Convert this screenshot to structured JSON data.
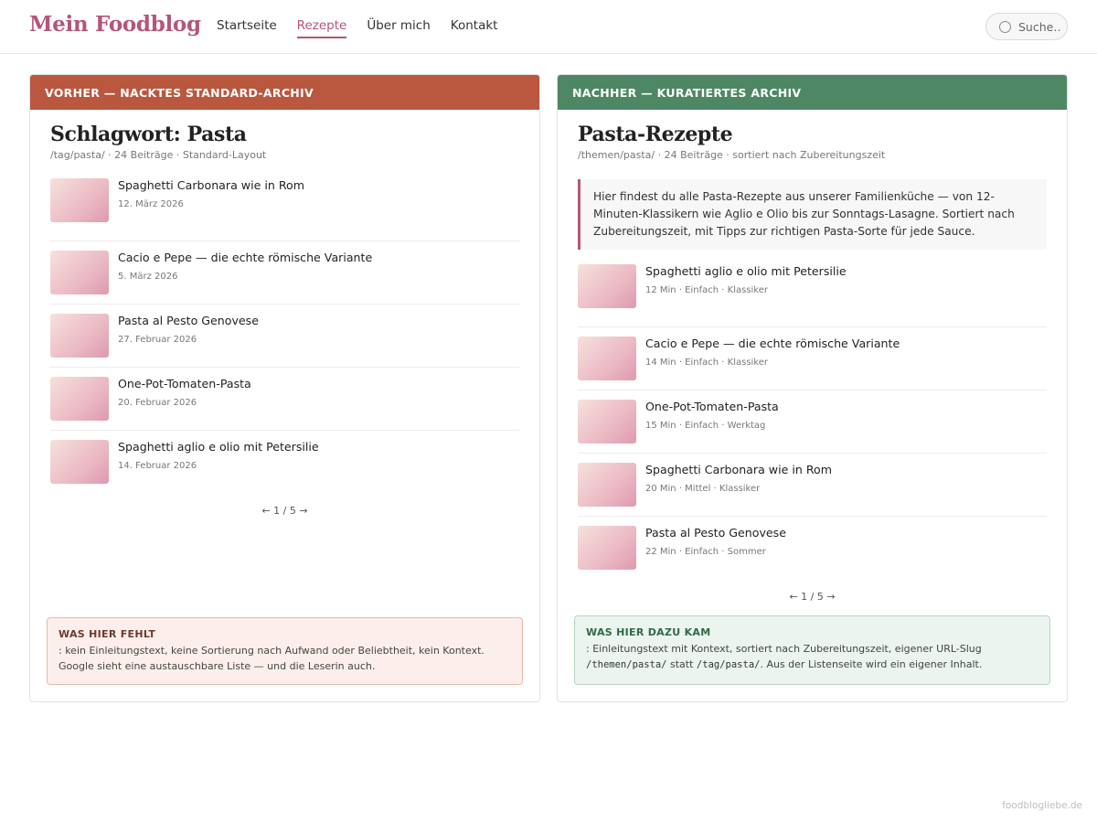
{
  "site": {
    "brand": "Mein Foodblog",
    "nav": [
      "Startseite",
      "Rezepte",
      "Über mich",
      "Kontakt"
    ],
    "active_nav": "Rezepte",
    "search_placeholder": "Suche…",
    "credit": "foodblogliebe.de"
  },
  "colors": {
    "brand": "#b5557a",
    "before_header": "#b9573f",
    "after_header": "#4e8764"
  },
  "before": {
    "header": "VORHER — NACKTES STANDARD-ARCHIV",
    "title": "Schlagwort: Pasta",
    "meta": "/tag/pasta/ · 24 Beiträge · Standard-Layout",
    "items": [
      {
        "title": "Spaghetti Carbonara wie in Rom",
        "sub": "12. März 2026"
      },
      {
        "title": "Cacio e Pepe — die echte römische Variante",
        "sub": "5. März 2026"
      },
      {
        "title": "Pasta al Pesto Genovese",
        "sub": "27. Februar 2026"
      },
      {
        "title": "One-Pot-Tomaten-Pasta",
        "sub": "20. Februar 2026"
      },
      {
        "title": "Spaghetti aglio e olio mit Petersilie",
        "sub": "14. Februar 2026"
      }
    ],
    "pager": "← 1 / 5 →",
    "note_title": "WAS HIER FEHLT",
    "note_text": ": kein Einleitungstext, keine Sortierung nach Aufwand oder Beliebtheit, kein Kontext. Google sieht eine austauschbare Liste — und die Leserin auch."
  },
  "after": {
    "header": "NACHHER — KURATIERTES ARCHIV",
    "title": "Pasta-Rezepte",
    "meta": "/themen/pasta/ · 24 Beiträge · sortiert nach Zubereitungszeit",
    "intro": "Hier findest du alle Pasta-Rezepte aus unserer Familienküche — von 12-Minuten-Klassikern wie Aglio e Olio bis zur Sonntags-Lasagne. Sortiert nach Zubereitungszeit, mit Tipps zur richtigen Pasta-Sorte für jede Sauce.",
    "items": [
      {
        "title": "Spaghetti aglio e olio mit Petersilie",
        "sub": "12 Min · Einfach · Klassiker"
      },
      {
        "title": "Cacio e Pepe — die echte römische Variante",
        "sub": "14 Min · Einfach · Klassiker"
      },
      {
        "title": "One-Pot-Tomaten-Pasta",
        "sub": "15 Min · Einfach · Werktag"
      },
      {
        "title": "Spaghetti Carbonara wie in Rom",
        "sub": "20 Min · Mittel · Klassiker"
      },
      {
        "title": "Pasta al Pesto Genovese",
        "sub": "22 Min · Einfach · Sommer"
      }
    ],
    "pager": "← 1 / 5 →",
    "note_title": "WAS HIER DAZU KAM",
    "note_text_1": ": Einleitungstext mit Kontext, sortiert nach Zubereitungszeit, eigener URL-Slug ",
    "note_code_1": "/themen/pasta/",
    "note_text_2": " statt ",
    "note_code_2": "/tag/pasta/",
    "note_text_3": ". Aus der Listenseite wird ein eigener Inhalt."
  }
}
